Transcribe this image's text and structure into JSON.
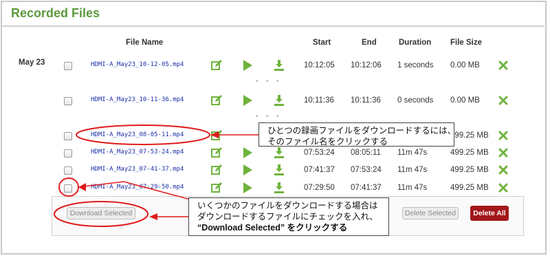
{
  "title": "Recorded Files",
  "columns": {
    "file_name": "File Name",
    "start": "Start",
    "end": "End",
    "duration": "Duration",
    "file_size": "File Size"
  },
  "date_label": "May 23",
  "ellipsis": "• • •",
  "rows": [
    {
      "name": "HDMI-A_May23_10-12-05.mp4",
      "start": "10:12:05",
      "end": "10:12:06",
      "duration": "1 seconds",
      "size": "0.00 MB"
    },
    {
      "name": "HDMI-A_May23_10-11-36.mp4",
      "start": "10:11:36",
      "end": "10:11:36",
      "duration": "0 seconds",
      "size": "0.00 MB"
    },
    {
      "name": "HDMI-A_May23_08-05-11.mp4",
      "start": "",
      "end": "",
      "duration": "",
      "size": "499.25 MB"
    },
    {
      "name": "HDMI-A_May23_07-53-24.mp4",
      "start": "07:53:24",
      "end": "08:05:11",
      "duration": "11m 47s",
      "size": "499.25 MB"
    },
    {
      "name": "HDMI-A_May23_07-41-37.mp4",
      "start": "07:41:37",
      "end": "07:53:24",
      "duration": "11m 47s",
      "size": "499.25 MB"
    },
    {
      "name": "HDMI-A_May23_07-29-50.mp4",
      "start": "07:29:50",
      "end": "07:41:37",
      "duration": "11m 47s",
      "size": "499.25 MB"
    }
  ],
  "buttons": {
    "download_selected": "Download Selected",
    "delete_selected": "Delete Selected",
    "delete_all": "Delete All"
  },
  "callouts": {
    "single": [
      "ひとつの録画ファイルをダウンロードするには、",
      "そのファイル名をクリックする"
    ],
    "multiple": [
      "いくつかのファイルをダウンロードする場合は",
      "ダウンロードするファイルにチェックを入れ、",
      "“Download Selected” をクリックする"
    ]
  },
  "colors": {
    "title": "#5b9a3c",
    "icon_green": "#6fb33c",
    "link": "#1c2fa8",
    "delete_all": "#a3181b",
    "annotation": "#e01b1b"
  },
  "icons": {
    "edit": "edit-icon",
    "play": "play-icon",
    "download": "download-icon",
    "delete": "delete-x-icon"
  }
}
